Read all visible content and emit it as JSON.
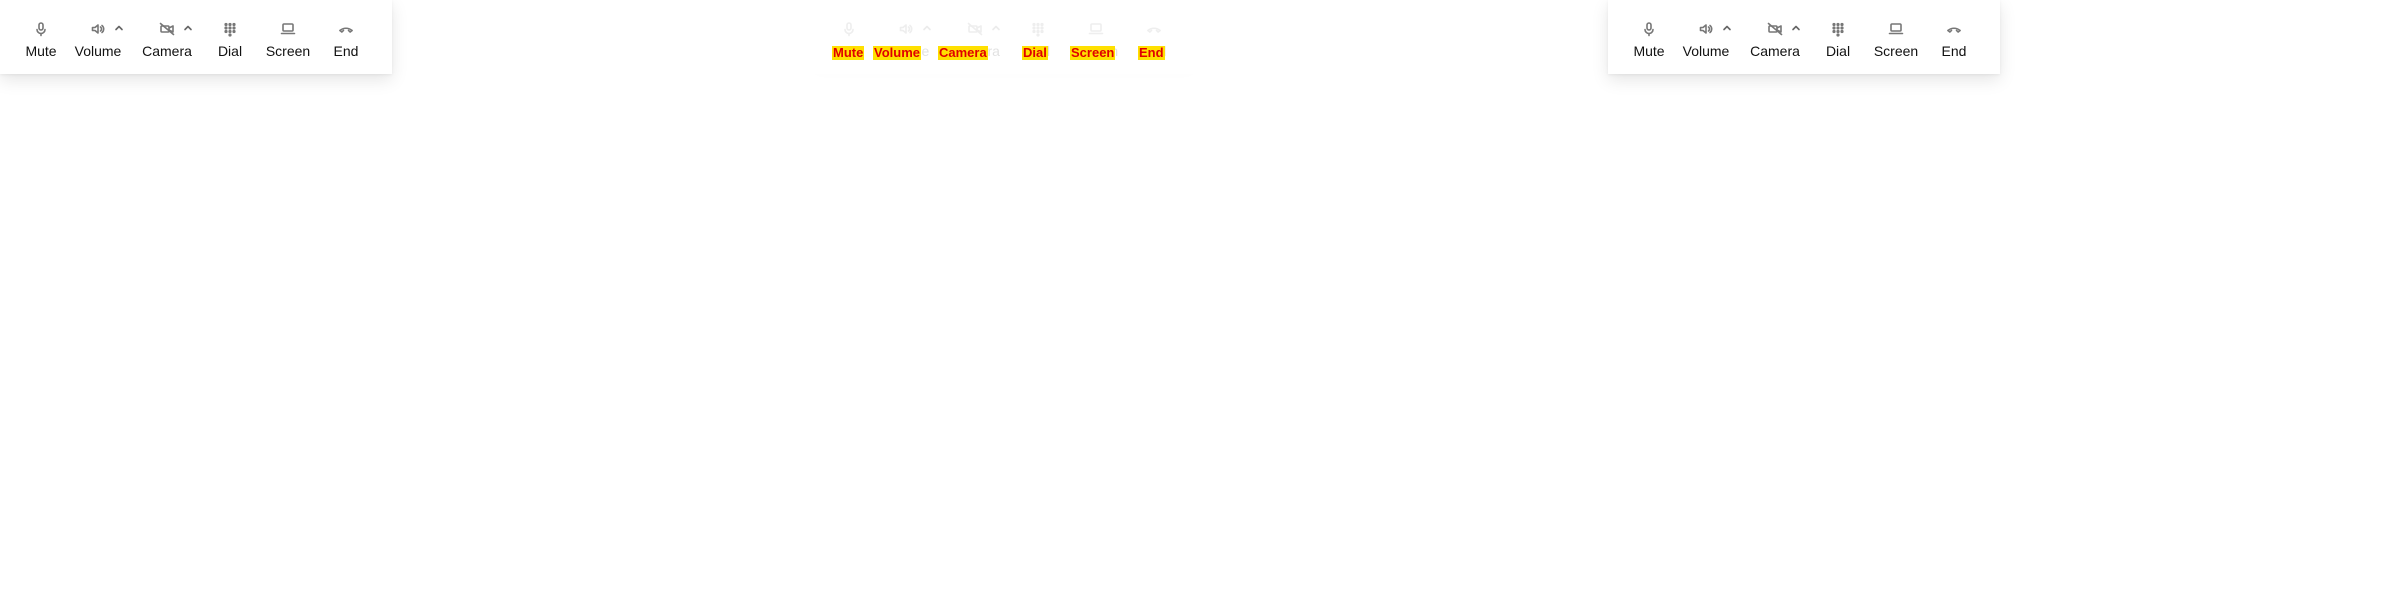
{
  "toolbars": [
    {
      "items": [
        {
          "key": "mute",
          "label": "Mute",
          "icon": "microphone-icon",
          "has_caret": false
        },
        {
          "key": "volume",
          "label": "Volume",
          "icon": "speaker-icon",
          "has_caret": true
        },
        {
          "key": "camera",
          "label": "Camera",
          "icon": "camera-off-icon",
          "has_caret": true
        },
        {
          "key": "dial",
          "label": "Dial",
          "icon": "dialpad-icon",
          "has_caret": false
        },
        {
          "key": "screen",
          "label": "Screen",
          "icon": "laptop-icon",
          "has_caret": false
        },
        {
          "key": "end",
          "label": "End",
          "icon": "end-call-icon",
          "has_caret": false
        }
      ]
    },
    {
      "items": [
        {
          "key": "mute",
          "label": "Mute",
          "icon": "microphone-icon",
          "has_caret": false
        },
        {
          "key": "volume",
          "label": "Volume",
          "icon": "speaker-icon",
          "has_caret": true
        },
        {
          "key": "camera",
          "label": "Camera",
          "icon": "camera-off-icon",
          "has_caret": true
        },
        {
          "key": "dial",
          "label": "Dial",
          "icon": "dialpad-icon",
          "has_caret": false
        },
        {
          "key": "screen",
          "label": "Screen",
          "icon": "laptop-icon",
          "has_caret": false
        },
        {
          "key": "end",
          "label": "End",
          "icon": "end-call-icon",
          "has_caret": false
        }
      ]
    },
    {
      "items": [
        {
          "key": "mute",
          "label": "Mute",
          "icon": "microphone-icon",
          "has_caret": false
        },
        {
          "key": "volume",
          "label": "Volume",
          "icon": "speaker-icon",
          "has_caret": true
        },
        {
          "key": "camera",
          "label": "Camera",
          "icon": "camera-off-icon",
          "has_caret": true
        },
        {
          "key": "dial",
          "label": "Dial",
          "icon": "dialpad-icon",
          "has_caret": false
        },
        {
          "key": "screen",
          "label": "Screen",
          "icon": "laptop-icon",
          "has_caret": false
        },
        {
          "key": "end",
          "label": "End",
          "icon": "end-call-icon",
          "has_caret": false
        }
      ]
    }
  ],
  "colors": {
    "text": "#111111",
    "icon": "#777777",
    "overlay_text": "#e00000",
    "overlay_bg": "#ffe000"
  }
}
